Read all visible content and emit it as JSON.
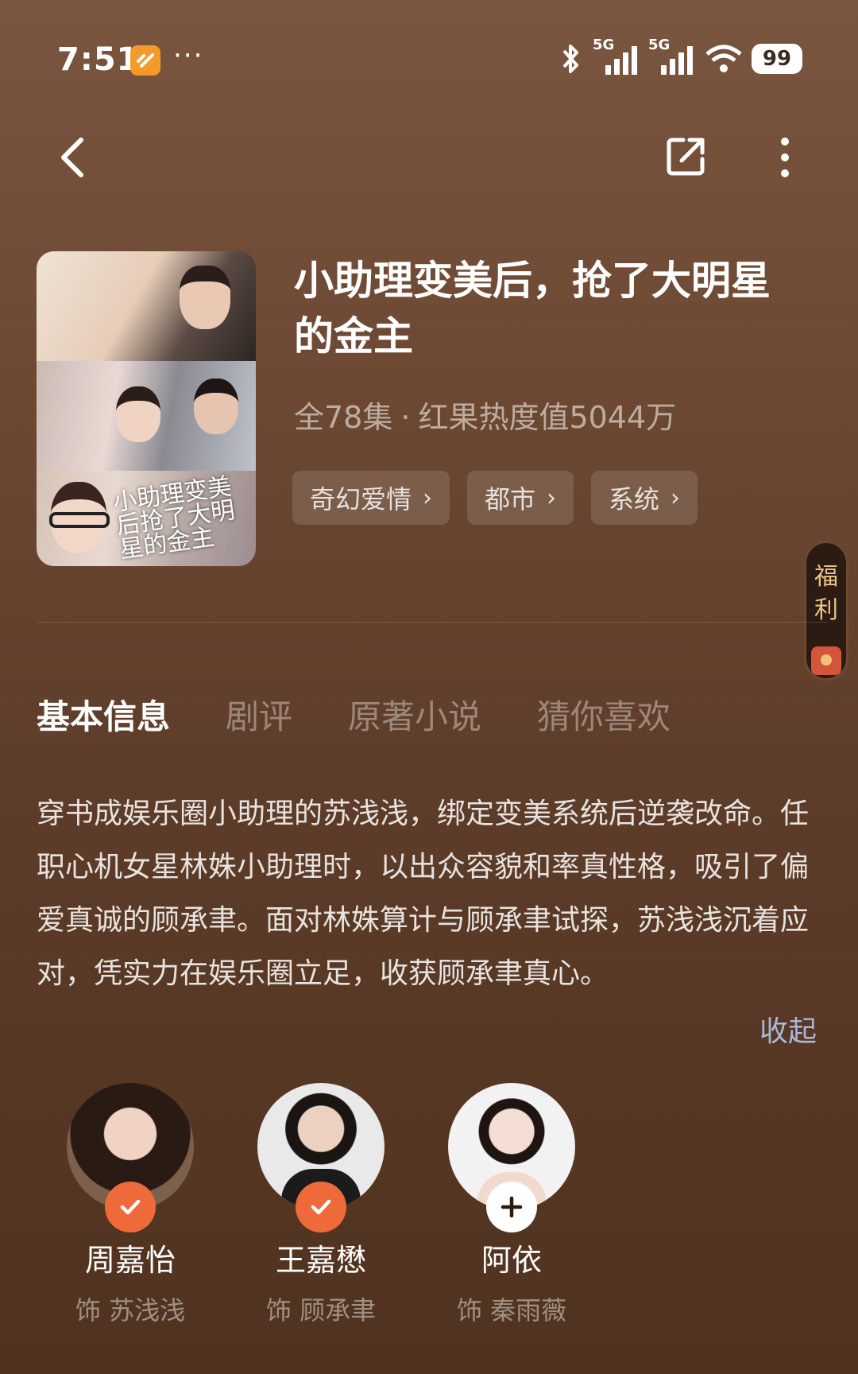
{
  "status_bar": {
    "time": "7:51",
    "dots": "···",
    "network_1": "5G",
    "network_2": "5G",
    "battery": "99"
  },
  "nav": {
    "back_icon": "chevron-left-icon",
    "share_icon": "share-icon",
    "more_icon": "more-vertical-icon"
  },
  "drama": {
    "title": "小助理变美后，抢了大明星的金主",
    "poster_title": "小助理变美后抢了大明星的金主",
    "episodes": "全78集",
    "separator": "·",
    "heat": "红果热度值5044万",
    "tags": [
      {
        "label": "奇幻爱情"
      },
      {
        "label": "都市"
      },
      {
        "label": "系统"
      }
    ]
  },
  "welfare": {
    "label_1": "福",
    "label_2": "利"
  },
  "tabs": [
    {
      "label": "基本信息",
      "active": true
    },
    {
      "label": "剧评",
      "active": false
    },
    {
      "label": "原著小说",
      "active": false
    },
    {
      "label": "猜你喜欢",
      "active": false
    }
  ],
  "synopsis": {
    "text": "穿书成娱乐圈小助理的苏浅浅，绑定变美系统后逆袭改命。任职心机女星林姝小助理时，以出众容貌和率真性格，吸引了偏爱真诚的顾承聿。面对林姝算计与顾承聿试探，苏浅浅沉着应对，凭实力在娱乐圈立足，收获顾承聿真心。",
    "collapse_label": "收起"
  },
  "cast": [
    {
      "name": "周嘉怡",
      "role": "饰 苏浅浅",
      "followed": true
    },
    {
      "name": "王嘉懋",
      "role": "饰 顾承聿",
      "followed": true
    },
    {
      "name": "阿依",
      "role": "饰 秦雨薇",
      "followed": false
    }
  ],
  "colors": {
    "accent_orange": "#ee6a3a",
    "link_blue": "#a9b9d8",
    "bg_top": "#7a5640",
    "bg_bottom": "#4f321f"
  }
}
